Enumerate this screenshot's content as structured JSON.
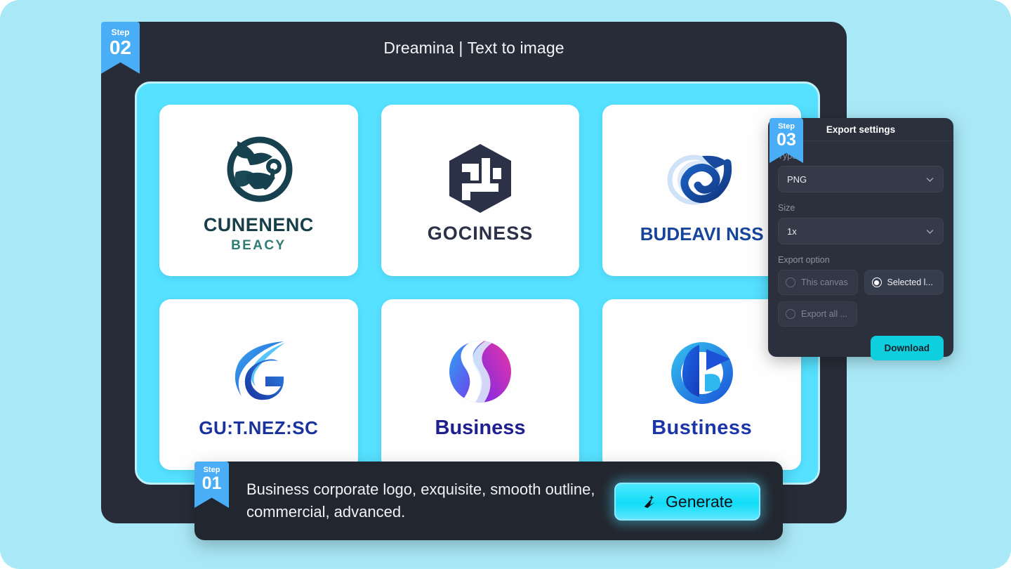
{
  "app": {
    "title": "Dreamina | Text to image"
  },
  "steps": [
    {
      "id": "step-01",
      "word": "Step",
      "number": "01"
    },
    {
      "id": "step-02",
      "word": "Step",
      "number": "02"
    },
    {
      "id": "step-03",
      "word": "Step",
      "number": "03"
    }
  ],
  "canvas": {
    "background_color": "#55e1ff",
    "border_color": "#bdf0fb",
    "logos": [
      {
        "name": "CUNENENC",
        "sub": "BEACY",
        "name_color": "#173e49",
        "sub_color": "#2e7d73",
        "mark": "leaf-circle-mark"
      },
      {
        "name": "GOCINESS",
        "sub": "",
        "name_color": "#2b3248",
        "sub_color": "",
        "mark": "cube-monogram-mark"
      },
      {
        "name": "BUDEAVI NSS",
        "sub": "",
        "name_color": "#17459b",
        "sub_color": "",
        "mark": "swirl-shell-mark"
      },
      {
        "name": "GU:T.NEZ:SC",
        "sub": "",
        "name_color": "#18329e",
        "sub_color": "",
        "mark": "flame-g-mark"
      },
      {
        "name": "Business",
        "sub": "",
        "name_color": "#1f1f8f",
        "sub_color": "",
        "mark": "gradient-sphere-mark"
      },
      {
        "name": "Bustiness",
        "sub": "",
        "name_color": "#1b36a8",
        "sub_color": "",
        "mark": "blue-b-circle-mark"
      }
    ]
  },
  "export_settings": {
    "heading": "Export settings",
    "type_label": "Type",
    "type_value": "PNG",
    "size_label": "Size",
    "size_value": "1x",
    "export_option_label": "Export option",
    "options": [
      {
        "label": "This canvas",
        "selected": false
      },
      {
        "label": "Selected l...",
        "selected": true
      },
      {
        "label": "Export all ...",
        "selected": false
      }
    ],
    "download_label": "Download",
    "accent_color": "#0fcede"
  },
  "prompt": {
    "text": "Business corporate logo, exquisite, smooth outline, commercial, advanced.",
    "generate_label": "Generate",
    "generate_color": "#11dcf7"
  }
}
